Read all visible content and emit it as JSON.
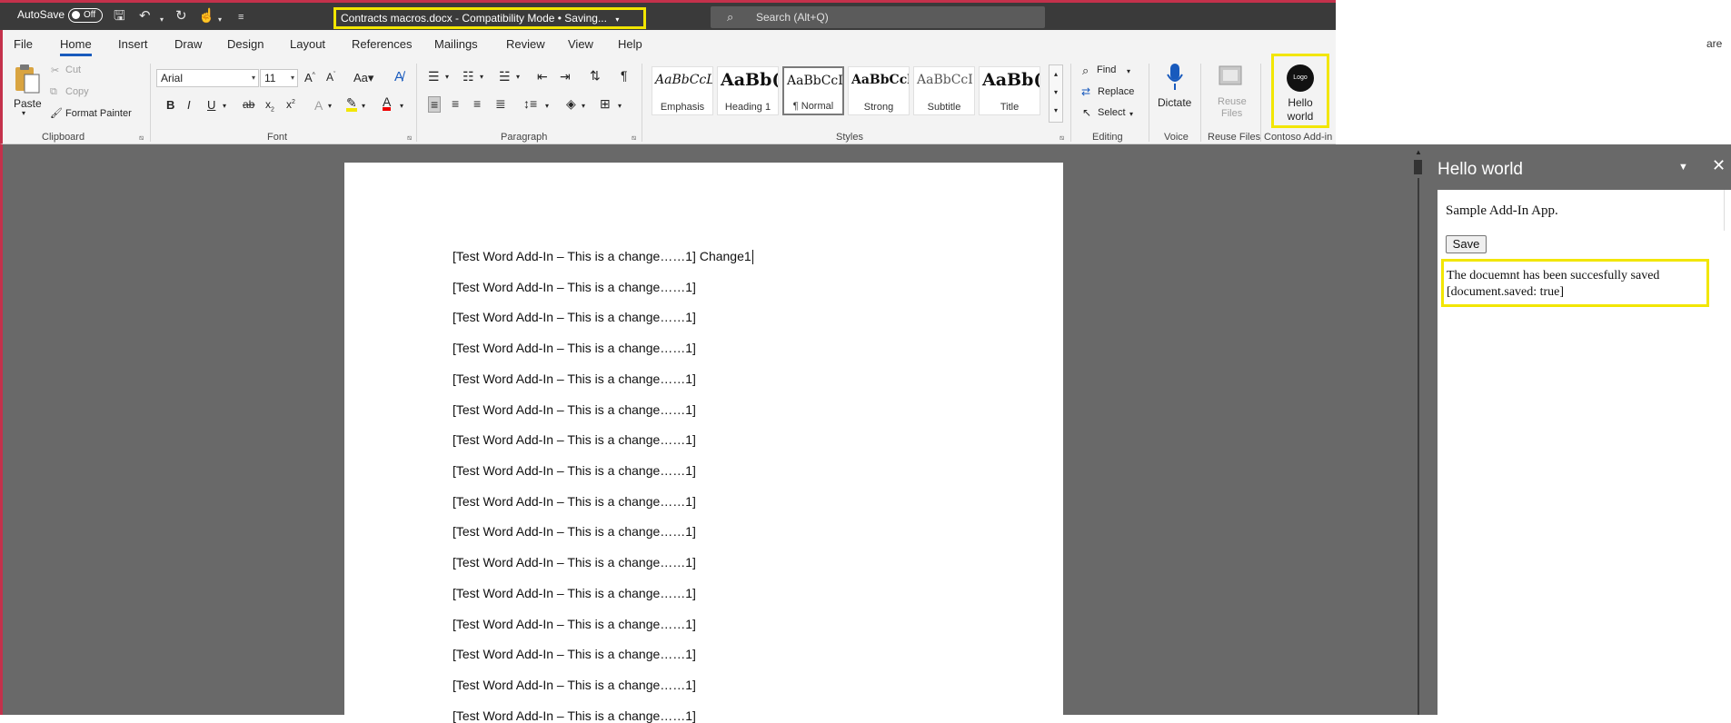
{
  "titlebar": {
    "autosave_label": "AutoSave",
    "autosave_state": "Off",
    "doc_title": "Contracts macros.docx  -  Compatibility Mode • Saving...",
    "search_placeholder": "Search (Alt+Q)",
    "border_color": "#c4314b",
    "highlight_color": "#f2e600"
  },
  "share_partial": "are",
  "menu": [
    "File",
    "Home",
    "Insert",
    "Draw",
    "Design",
    "Layout",
    "References",
    "Mailings",
    "Review",
    "View",
    "Help"
  ],
  "clipboard": {
    "paste": "Paste",
    "cut": "Cut",
    "copy": "Copy",
    "format_painter": "Format Painter",
    "group": "Clipboard"
  },
  "font": {
    "family": "Arial",
    "size": "11",
    "group": "Font"
  },
  "paragraph": {
    "group": "Paragraph"
  },
  "styles": {
    "group": "Styles",
    "tiles": [
      {
        "sample": "AaBbCcL",
        "name": "Emphasis"
      },
      {
        "sample": "AaBb(",
        "name": "Heading 1"
      },
      {
        "sample": "AaBbCcI",
        "name": "¶ Normal"
      },
      {
        "sample": "AaBbCcl",
        "name": "Strong"
      },
      {
        "sample": "AaBbCcI",
        "name": "Subtitle"
      },
      {
        "sample": "AaBb(",
        "name": "Title"
      }
    ]
  },
  "editing": {
    "find": "Find",
    "replace": "Replace",
    "select": "Select",
    "group": "Editing"
  },
  "voice": {
    "dictate": "Dictate",
    "group": "Voice"
  },
  "reuse": {
    "line1": "Reuse",
    "line2": "Files",
    "group": "Reuse Files"
  },
  "addin_group": {
    "group": "Contoso Add-in",
    "button_line1": "Hello",
    "button_line2": "world",
    "logo_text": "Logo"
  },
  "document": {
    "lines": [
      "[Test Word Add-In – This is a change……1] Change1",
      "[Test Word Add-In – This is a change……1]",
      "[Test Word Add-In – This is a change……1]",
      "[Test Word Add-In – This is a change……1]",
      "[Test Word Add-In – This is a change……1]",
      "[Test Word Add-In – This is a change……1]",
      "[Test Word Add-In – This is a change……1]",
      "[Test Word Add-In – This is a change……1]",
      "[Test Word Add-In – This is a change……1]",
      "[Test Word Add-In – This is a change……1]",
      "[Test Word Add-In – This is a change……1]",
      "[Test Word Add-In – This is a change……1]",
      "[Test Word Add-In – This is a change……1]",
      "[Test Word Add-In – This is a change……1]",
      "[Test Word Add-In – This is a change……1]",
      "[Test Word Add-In – This is a change……1]"
    ]
  },
  "taskpane": {
    "title": "Hello world",
    "description": "Sample Add-In App.",
    "save_label": "Save",
    "status_line1": "The docuemnt has been succesfully saved",
    "status_line2": "[document.saved: true]"
  }
}
